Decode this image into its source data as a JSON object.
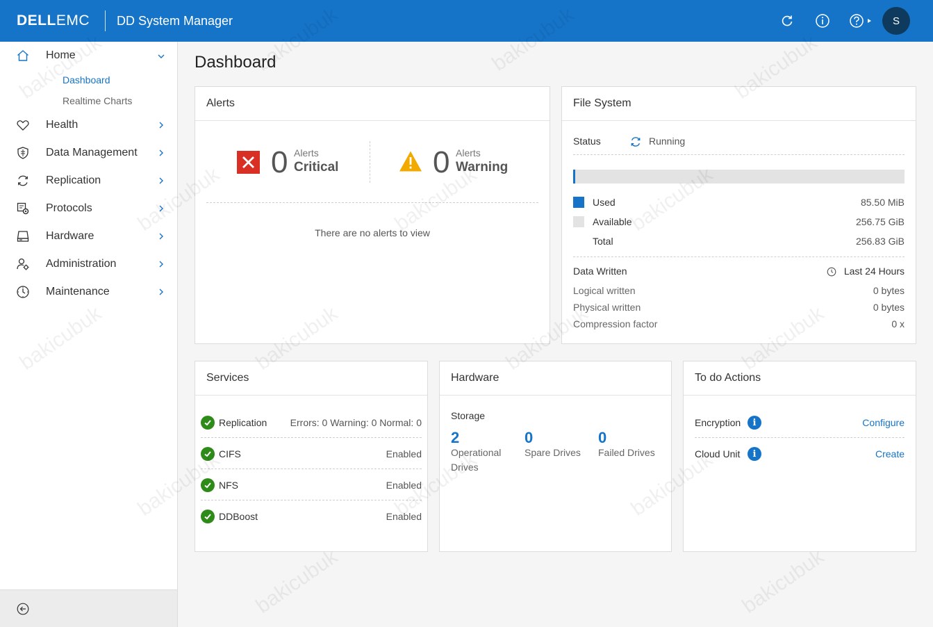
{
  "header": {
    "logo_dell": "DELL",
    "logo_emc": "EMC",
    "title": "DD System Manager",
    "user_initial": "S",
    "brand_color": "#1674c8"
  },
  "sidebar": {
    "items": [
      {
        "label": "Home",
        "icon": "home-icon"
      },
      {
        "label": "Health",
        "icon": "heart-icon"
      },
      {
        "label": "Data Management",
        "icon": "shield-icon"
      },
      {
        "label": "Replication",
        "icon": "refresh-icon"
      },
      {
        "label": "Protocols",
        "icon": "protocols-icon"
      },
      {
        "label": "Hardware",
        "icon": "drive-icon"
      },
      {
        "label": "Administration",
        "icon": "admin-user-icon"
      },
      {
        "label": "Maintenance",
        "icon": "clock-icon"
      }
    ],
    "home_subitems": [
      "Dashboard",
      "Realtime Charts"
    ],
    "active_subitem": "Dashboard"
  },
  "main": {
    "page_title": "Dashboard",
    "alerts": {
      "title": "Alerts",
      "critical_count": "0",
      "critical_small": "Alerts",
      "critical_label": "Critical",
      "warning_count": "0",
      "warning_small": "Alerts",
      "warning_label": "Warning",
      "empty_message": "There are no alerts to view"
    },
    "file_system": {
      "title": "File System",
      "status_label": "Status",
      "status_value": "Running",
      "used_label": "Used",
      "used_value": "85.50 MiB",
      "available_label": "Available",
      "available_value": "256.75 GiB",
      "total_label": "Total",
      "total_value": "256.83 GiB",
      "usage_fraction": 0.003,
      "data_written_label": "Data Written",
      "period": "Last 24 Hours",
      "logical_label": "Logical written",
      "logical_value": "0 bytes",
      "physical_label": "Physical written",
      "physical_value": "0 bytes",
      "compression_label": "Compression factor",
      "compression_value": "0 x"
    },
    "services": {
      "title": "Services",
      "rows": [
        {
          "name": "Replication",
          "status": "Errors: 0 Warning: 0 Normal: 0"
        },
        {
          "name": "CIFS",
          "status": "Enabled"
        },
        {
          "name": "NFS",
          "status": "Enabled"
        },
        {
          "name": "DDBoost",
          "status": "Enabled"
        }
      ]
    },
    "hardware": {
      "title": "Hardware",
      "section": "Storage",
      "operational_count": "2",
      "operational_label": "Operational Drives",
      "spare_count": "0",
      "spare_label": "Spare Drives",
      "failed_count": "0",
      "failed_label": "Failed Drives"
    },
    "todo": {
      "title": "To do Actions",
      "rows": [
        {
          "name": "Encryption",
          "action": "Configure"
        },
        {
          "name": "Cloud Unit",
          "action": "Create"
        }
      ]
    }
  },
  "watermark": "bakicubuk"
}
